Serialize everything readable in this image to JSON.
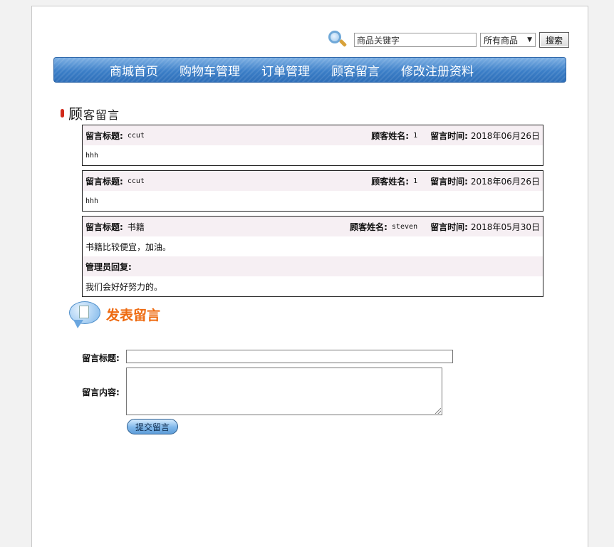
{
  "search": {
    "placeholder": "商品关键字",
    "category": "所有商品",
    "button": "搜索"
  },
  "nav": {
    "items": [
      "商城首页",
      "购物车管理",
      "订单管理",
      "顾客留言",
      "修改注册资料"
    ]
  },
  "section": {
    "title_first": "顾",
    "title_rest": "客留言"
  },
  "labels": {
    "msg_title": "留言标题:",
    "customer_name": "顾客姓名:",
    "msg_time": "留言时间:",
    "admin_reply": "管理员回复:"
  },
  "messages": [
    {
      "title": "ccut",
      "name": "1",
      "time": "2018年06月26日",
      "content": "hhh"
    },
    {
      "title": "ccut",
      "name": "1",
      "time": "2018年06月26日",
      "content": "hhh"
    },
    {
      "title": "书籍",
      "name": "steven",
      "time": "2018年05月30日",
      "content": "书籍比较便宜，加油。",
      "reply": "我们会好好努力的。"
    }
  ],
  "post": {
    "heading": "发表留言",
    "title_label": "留言标题:",
    "content_label": "留言内容:",
    "submit": "提交留言"
  }
}
